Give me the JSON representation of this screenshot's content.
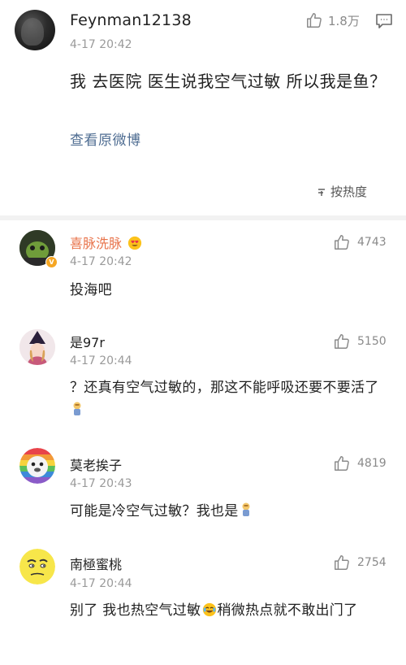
{
  "post": {
    "username": "Feynman12138",
    "time": "4-17 20:42",
    "likes": "1.8万",
    "text": "我 去医院 医生说我空气过敏 所以我是鱼？",
    "view_original": "查看原微博",
    "sort_label": "按热度"
  },
  "comments": [
    {
      "username": "喜脉洗脉",
      "time": "4-17 20:42",
      "likes": "4743",
      "text": "投海吧",
      "verified": true
    },
    {
      "username": "是97r",
      "time": "4-17 20:44",
      "likes": "5150",
      "text": "？还真有空气过敏的，那这不能呼吸还要不要活了"
    },
    {
      "username": "莫老挨子",
      "time": "4-17 20:43",
      "likes": "4819",
      "text": "可能是冷空气过敏？我也是"
    },
    {
      "username": "南極蜜桃",
      "time": "4-17 20:44",
      "likes": "2754",
      "text_before": "别了 我也热空气过敏",
      "text_after": "稍微热点就不敢出门了"
    }
  ],
  "colors": {
    "link": "#4f6d92",
    "meta": "#9a9a9a",
    "divider": "#f2f2f2",
    "verified_badge": "#f5a623"
  },
  "icons": [
    "thumbs-up-icon",
    "comment-icon",
    "sort-icon",
    "verified-badge-icon",
    "heart-eyes-emoji-icon",
    "facepalm-emoji-icon",
    "laugh-cry-emoji-icon"
  ]
}
